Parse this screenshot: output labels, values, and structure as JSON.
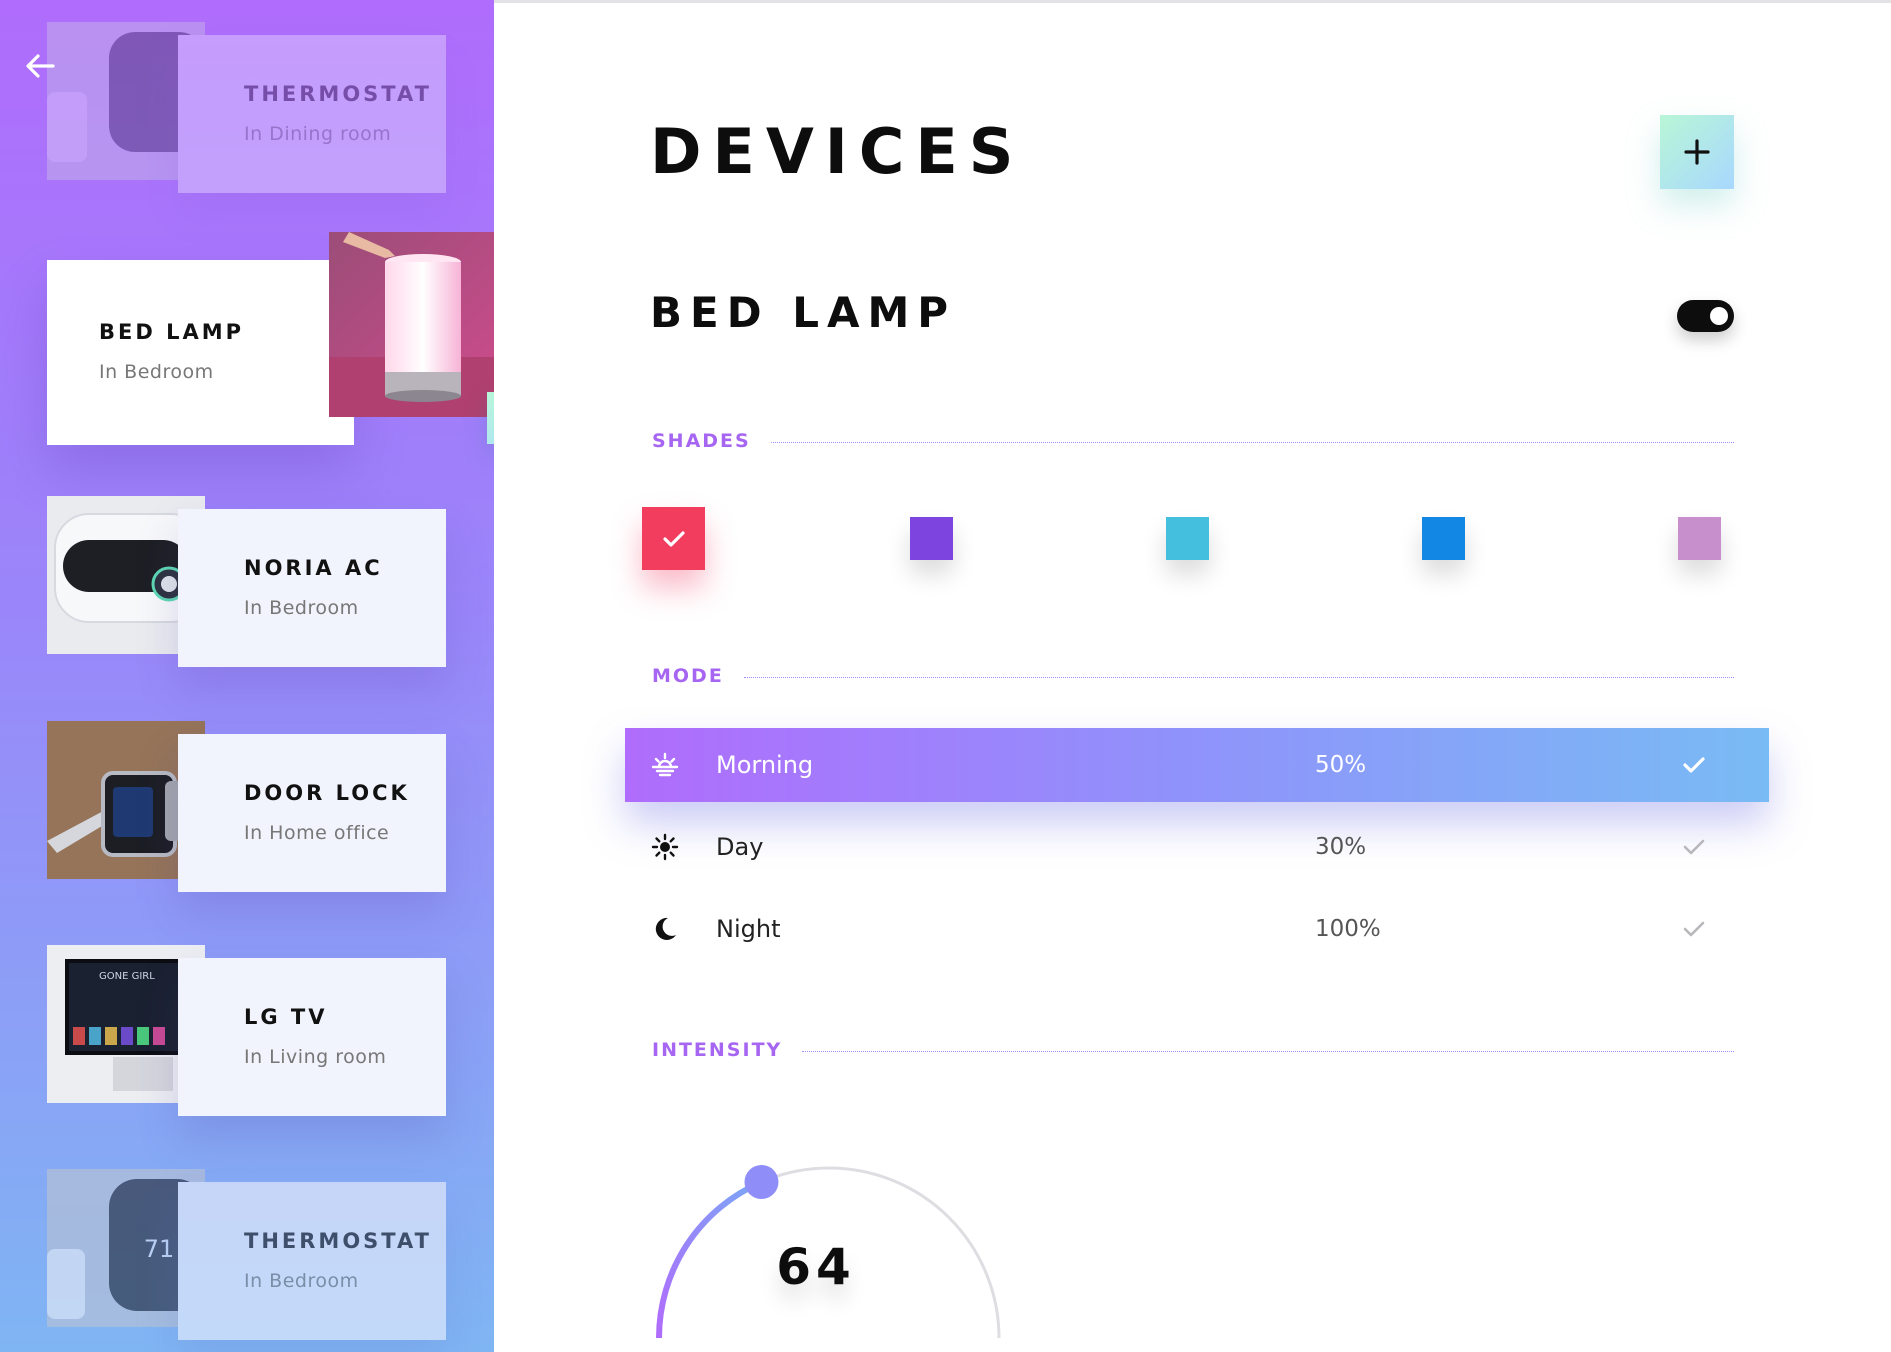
{
  "sidebar": {
    "devices": [
      {
        "name": "THERMOSTAT",
        "room": "In Dining room"
      },
      {
        "name": "BED LAMP",
        "room": "In Bedroom"
      },
      {
        "name": "NORIA AC",
        "room": "In Bedroom"
      },
      {
        "name": "DOOR LOCK",
        "room": "In Home office"
      },
      {
        "name": "LG TV",
        "room": "In Living room"
      },
      {
        "name": "THERMOSTAT",
        "room": "In Bedroom"
      }
    ],
    "tv_thumb_text": "GONE GIRL",
    "thermostat_reading": "71"
  },
  "main": {
    "title": "DEVICES",
    "device_name": "BED LAMP",
    "toggle_on": true,
    "shades": {
      "label": "SHADES",
      "colors": [
        "#f23d5e",
        "#7e44e0",
        "#44c0de",
        "#1288e4",
        "#c88fcd"
      ],
      "selected": 0
    },
    "mode": {
      "label": "MODE",
      "items": [
        {
          "name": "Morning",
          "percent": "50%",
          "icon": "sunrise-icon",
          "active": true
        },
        {
          "name": "Day",
          "percent": "30%",
          "icon": "sun-icon",
          "active": false
        },
        {
          "name": "Night",
          "percent": "100%",
          "icon": "moon-icon",
          "active": false
        }
      ]
    },
    "intensity": {
      "label": "INTENSITY",
      "value": "64",
      "fraction": 0.37
    }
  }
}
